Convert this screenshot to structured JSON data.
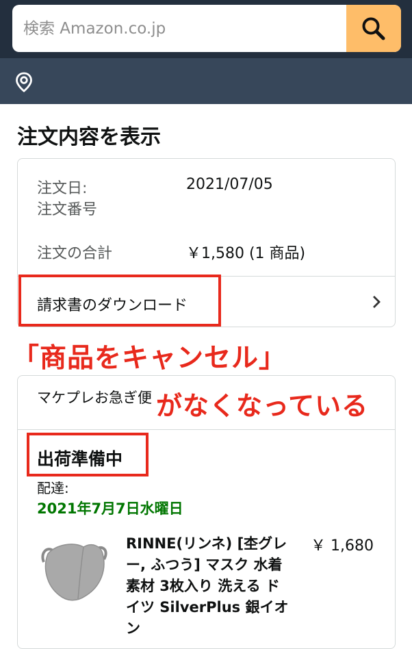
{
  "header": {
    "search_placeholder": "検索 Amazon.co.jp"
  },
  "page": {
    "title": "注文内容を表示"
  },
  "order_summary": {
    "order_date_label": "注文日:",
    "order_date_value": "2021/07/05",
    "order_number_label": "注文番号",
    "order_total_label": "注文の合計",
    "order_total_value": "￥1,580 (1 商品)",
    "invoice_download": "請求書のダウンロード"
  },
  "shipment": {
    "section_heading": "マケプレお急ぎ便",
    "status": "出荷準備中",
    "delivery_label": "配達:",
    "delivery_date": "2021年7月7日水曜日",
    "product": {
      "title": "RINNE(リンネ) [杢グレー, ふつう] マスク 水着素材 3枚入り 洗える ドイツ SilverPlus 銀イオン",
      "price": "￥ 1,680"
    }
  },
  "annotations": {
    "line1": "「商品をキャンセル」",
    "line2": "がなくなっている"
  },
  "colors": {
    "header_bg": "#232f3e",
    "location_bar_bg": "#37475a",
    "search_button": "#febd69",
    "annotation_red": "#e8291c",
    "delivery_green": "#007600"
  },
  "icons": [
    "search-icon",
    "location-pin-icon",
    "chevron-right-icon"
  ]
}
